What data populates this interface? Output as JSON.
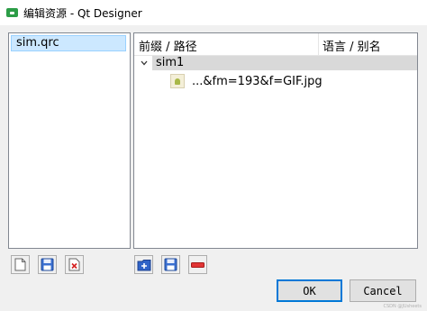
{
  "window": {
    "title": "编辑资源 - Qt Designer"
  },
  "left_list": {
    "items": [
      {
        "label": "sim.qrc"
      }
    ]
  },
  "tree": {
    "headers": {
      "prefix_path": "前缀 / 路径",
      "lang_alias": "语言 / 别名"
    },
    "prefix": {
      "label": "sim1",
      "expanded": true
    },
    "files": [
      {
        "label": "...&fm=193&f=GIF.jpg"
      }
    ]
  },
  "buttons": {
    "ok": "OK",
    "cancel": "Cancel"
  },
  "watermark": "CSDN @JUsheets",
  "icons": {
    "left_toolbar": [
      "new-file-icon",
      "save-icon",
      "remove-file-icon"
    ],
    "right_toolbar": [
      "add-prefix-icon",
      "save-icon",
      "remove-icon"
    ]
  }
}
